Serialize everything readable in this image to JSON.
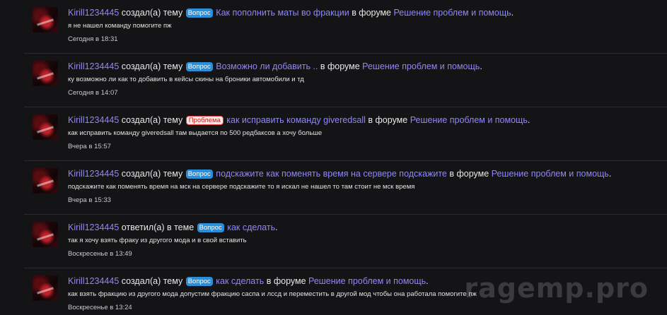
{
  "feed": {
    "items": [
      {
        "user": "Kirill1234445",
        "action": "создал(а) тему",
        "badge": "Вопрос",
        "topic": "Как пополнить маты во фракции",
        "in_forum": "в форуме",
        "forum": "Решение проблем и помощь",
        "snippet": "я не нашел команду помогите пж",
        "time": "Сегодня в 18:31"
      },
      {
        "user": "Kirill1234445",
        "action": "создал(а) тему",
        "badge": "Вопрос",
        "topic": "Возможно ли добавить ..",
        "in_forum": "в форуме",
        "forum": "Решение проблем и помощь",
        "snippet": "ку возможно ли как то добавить в кейсы скины на броники автомобили и тд",
        "time": "Сегодня в 14:07"
      },
      {
        "user": "Kirill1234445",
        "action": "создал(а) тему",
        "badge": "Проблема",
        "topic": "как исправить команду giveredsall",
        "in_forum": "в форуме",
        "forum": "Решение проблем и помощь",
        "snippet": "как исправить команду giveredsall там выдается по 500 редбаксов а хочу больше",
        "time": "Вчера в 15:57"
      },
      {
        "user": "Kirill1234445",
        "action": "создал(а) тему",
        "badge": "Вопрос",
        "topic": "подскажите как поменять время на сервере подскажите",
        "in_forum": "в форуме",
        "forum": "Решение проблем и помощь",
        "snippet": "подскажите как поменять время на мск на сервере подскажите то я искал не нашел то там стоит не мск время",
        "time": "Вчера в 15:33"
      },
      {
        "user": "Kirill1234445",
        "action": "ответил(а) в теме",
        "badge": "Вопрос",
        "topic": "как сделать",
        "in_forum": "",
        "forum": "",
        "snippet": "так я хочу взять фраку из другого мода и в свой вставить",
        "time": "Воскресенье в 13:49"
      },
      {
        "user": "Kirill1234445",
        "action": "создал(а) тему",
        "badge": "Вопрос",
        "topic": "как сделать",
        "in_forum": "в форуме",
        "forum": "Решение проблем и помощь",
        "snippet": "как взять фракцию из другого мода допустим фракцию саспа и лссд и переместить в другой мод чтобы она работала помогите пж",
        "time": "Воскресенье в 13:24"
      }
    ]
  },
  "watermark": "ragemp.pro",
  "colors": {
    "background": "#141416",
    "link": "#8f86ff",
    "badge_question": "#2b8fd8",
    "badge_problem_text": "#cc1f1f",
    "badge_problem_bg": "#fde6e6"
  }
}
